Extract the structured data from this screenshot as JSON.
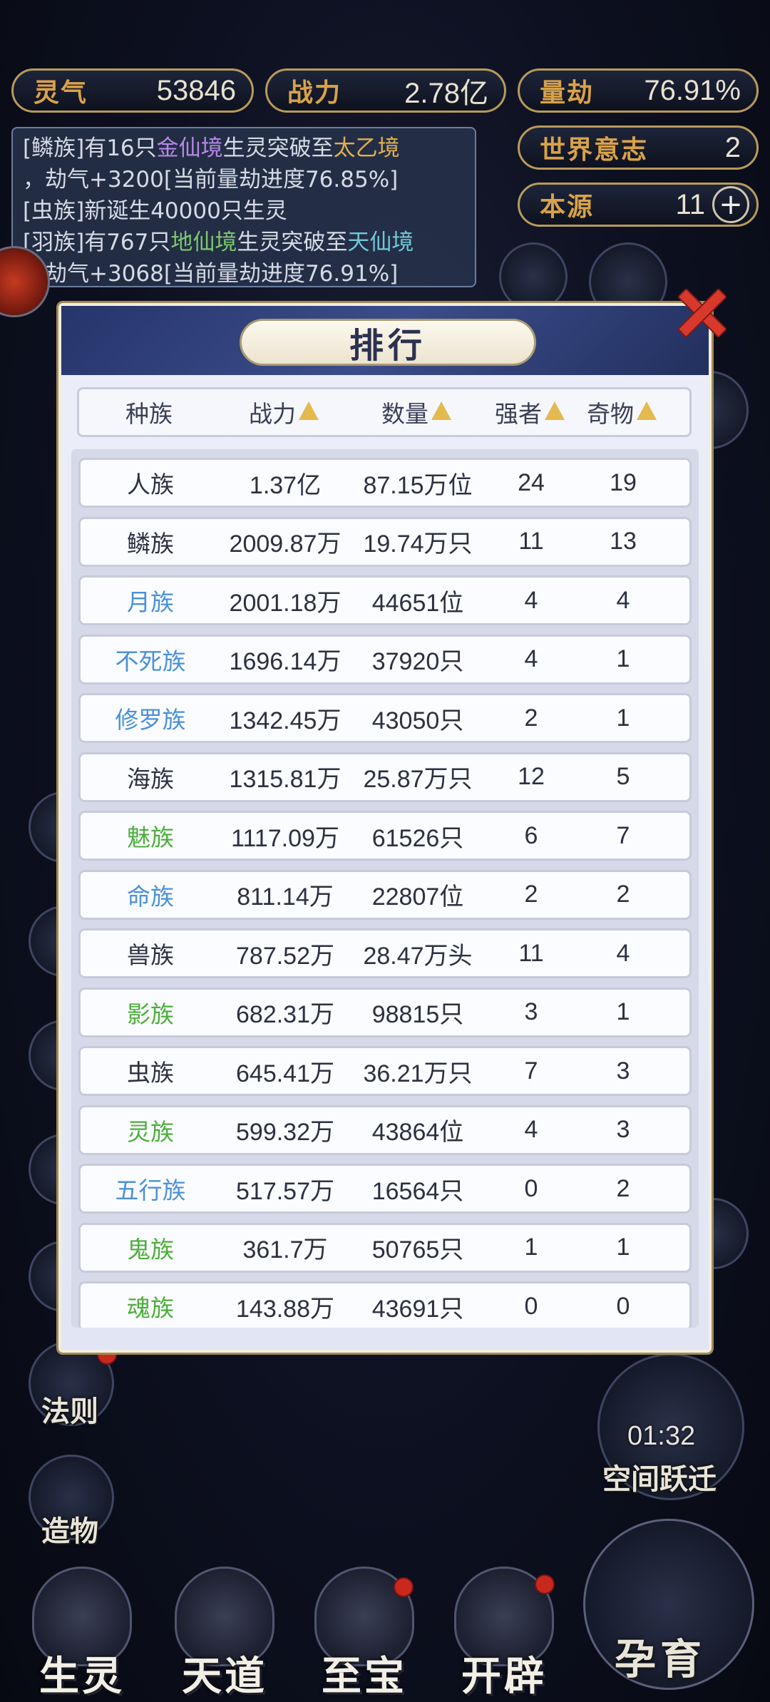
{
  "hud": {
    "lingqi": {
      "label": "灵气",
      "value": "53846"
    },
    "zhanli": {
      "label": "战力",
      "value": "2.78亿"
    },
    "liangjie": {
      "label": "量劫",
      "value": "76.91%"
    },
    "shijie": {
      "label": "世界意志",
      "value": "2"
    },
    "benyuan": {
      "label": "本源",
      "value": "11"
    }
  },
  "log": {
    "line1a": "[鳞族]有16只",
    "line1b": "金仙境",
    "line1c": "生灵突破至",
    "line1d": "太乙境",
    "line2": "，劫气+3200[当前量劫进度76.85%]",
    "line3": "[虫族]新诞生40000只生灵",
    "line4a": "[羽族]有767只",
    "line4b": "地仙境",
    "line4c": "生灵突破至",
    "line4d": "天仙境",
    "line5": "，劫气+3068[当前量劫进度76.91%]"
  },
  "panel": {
    "title": "排行",
    "columns": [
      "种族",
      "战力",
      "数量",
      "强者",
      "奇物"
    ],
    "rows": [
      {
        "name": "人族",
        "power": "1.37亿",
        "count": "87.15万位",
        "strong": "24",
        "items": "19",
        "color": "#2d3042"
      },
      {
        "name": "鳞族",
        "power": "2009.87万",
        "count": "19.74万只",
        "strong": "11",
        "items": "13",
        "color": "#2d3042"
      },
      {
        "name": "月族",
        "power": "2001.18万",
        "count": "44651位",
        "strong": "4",
        "items": "4",
        "color": "#4a90d9"
      },
      {
        "name": "不死族",
        "power": "1696.14万",
        "count": "37920只",
        "strong": "4",
        "items": "1",
        "color": "#4a90d9"
      },
      {
        "name": "修罗族",
        "power": "1342.45万",
        "count": "43050只",
        "strong": "2",
        "items": "1",
        "color": "#4a90d9"
      },
      {
        "name": "海族",
        "power": "1315.81万",
        "count": "25.87万只",
        "strong": "12",
        "items": "5",
        "color": "#2d3042"
      },
      {
        "name": "魅族",
        "power": "1117.09万",
        "count": "61526只",
        "strong": "6",
        "items": "7",
        "color": "#4cae3c"
      },
      {
        "name": "命族",
        "power": "811.14万",
        "count": "22807位",
        "strong": "2",
        "items": "2",
        "color": "#4a90d9"
      },
      {
        "name": "兽族",
        "power": "787.52万",
        "count": "28.47万头",
        "strong": "11",
        "items": "4",
        "color": "#2d3042"
      },
      {
        "name": "影族",
        "power": "682.31万",
        "count": "98815只",
        "strong": "3",
        "items": "1",
        "color": "#4cae3c"
      },
      {
        "name": "虫族",
        "power": "645.41万",
        "count": "36.21万只",
        "strong": "7",
        "items": "3",
        "color": "#2d3042"
      },
      {
        "name": "灵族",
        "power": "599.32万",
        "count": "43864位",
        "strong": "4",
        "items": "3",
        "color": "#4cae3c"
      },
      {
        "name": "五行族",
        "power": "517.57万",
        "count": "16564只",
        "strong": "0",
        "items": "2",
        "color": "#4a90d9"
      },
      {
        "name": "鬼族",
        "power": "361.7万",
        "count": "50765只",
        "strong": "1",
        "items": "1",
        "color": "#4cae3c"
      },
      {
        "name": "魂族",
        "power": "143.88万",
        "count": "43691只",
        "strong": "0",
        "items": "0",
        "color": "#4cae3c"
      }
    ]
  },
  "side": {
    "faze": "法则",
    "zaowu": "造物",
    "timer": "01:32",
    "kongjian": "空间跃迁"
  },
  "bottom": {
    "shengling": "生灵",
    "tiandao": "天道",
    "zhibao": "至宝",
    "kaipi": "开辟",
    "yunyu": "孕育"
  }
}
